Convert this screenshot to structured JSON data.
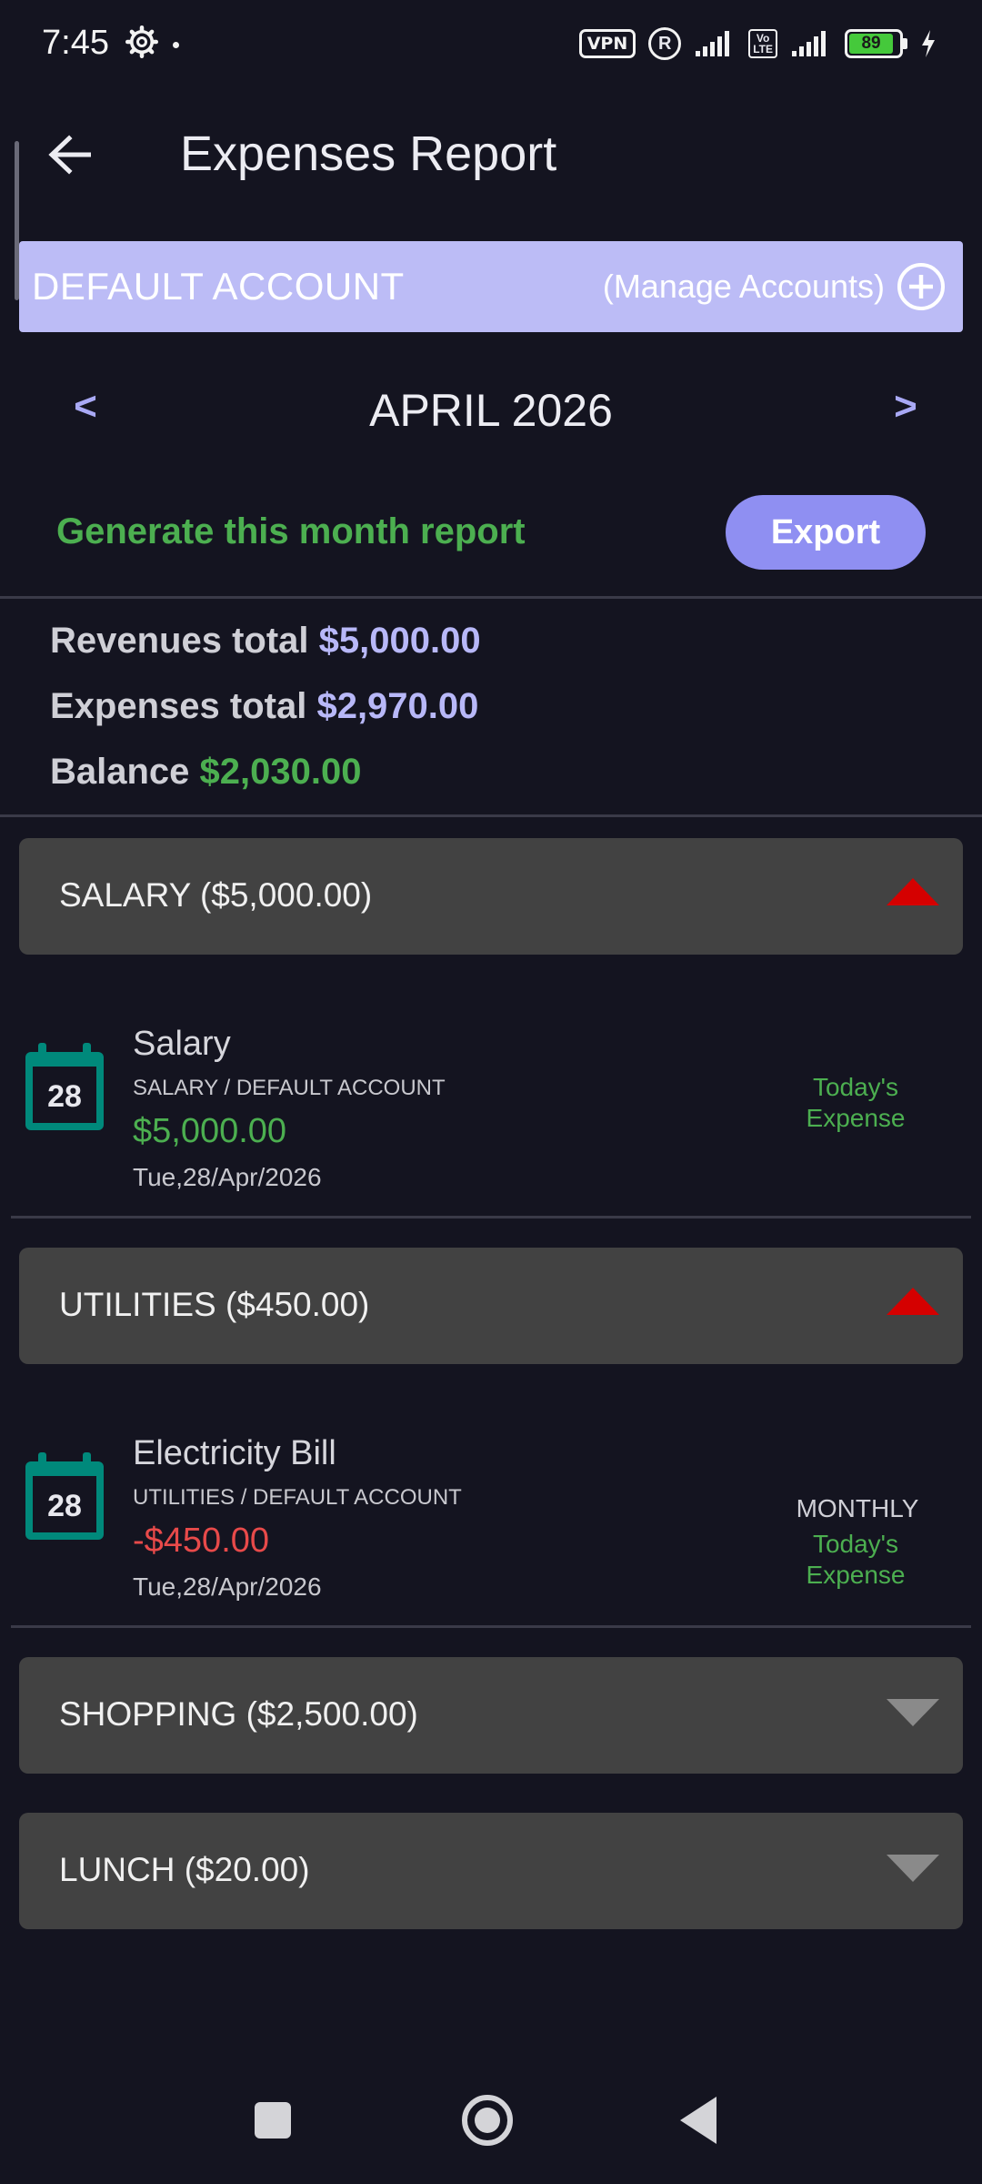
{
  "status_bar": {
    "time": "7:45",
    "vpn": "VPN",
    "registered": "R",
    "volte": "Vo\nLTE",
    "battery": "89",
    "battery_color": "#45c93b"
  },
  "app_bar": {
    "title": "Expenses Report",
    "back_icon": "arrow-left-icon"
  },
  "account": {
    "name": "DEFAULT ACCOUNT",
    "manage_label": "(Manage Accounts)",
    "add_icon": "plus-circle-icon",
    "bar_color": "#bcbcf6"
  },
  "month_nav": {
    "prev": "<",
    "month": "APRIL 2026",
    "next": ">"
  },
  "report": {
    "generate_label": "Generate this month report",
    "export_label": "Export"
  },
  "totals": {
    "revenues_label": "Revenues total",
    "revenues_value": "$5,000.00",
    "expenses_label": "Expenses total",
    "expenses_value": "$2,970.00",
    "balance_label": "Balance",
    "balance_value": "$2,030.00"
  },
  "categories": [
    {
      "label": "SALARY ($5,000.00)",
      "expanded": true,
      "transactions": [
        {
          "day": "28",
          "title": "Salary",
          "sub": "SALARY / DEFAULT ACCOUNT",
          "amount": "$5,000.00",
          "date": "Tue,28/Apr/2026",
          "recurrence": "",
          "tag_line1": "Today's",
          "tag_line2": "Expense"
        }
      ]
    },
    {
      "label": "UTILITIES ($450.00)",
      "expanded": true,
      "transactions": [
        {
          "day": "28",
          "title": "Electricity Bill",
          "sub": "UTILITIES / DEFAULT ACCOUNT",
          "amount": "-$450.00",
          "date": "Tue,28/Apr/2026",
          "recurrence": "MONTHLY",
          "tag_line1": "Today's",
          "tag_line2": "Expense"
        }
      ]
    },
    {
      "label": "SHOPPING ($2,500.00)",
      "expanded": false,
      "transactions": []
    },
    {
      "label": "LUNCH ($20.00)",
      "expanded": false,
      "transactions": []
    }
  ],
  "colors": {
    "background": "#141420",
    "accent": "#8f8ff2",
    "positive": "#4caf50",
    "negative": "#e84a4a",
    "collapse_arrow": "#d50000",
    "expand_arrow": "#8a8a8a",
    "calendar": "#00897b"
  }
}
